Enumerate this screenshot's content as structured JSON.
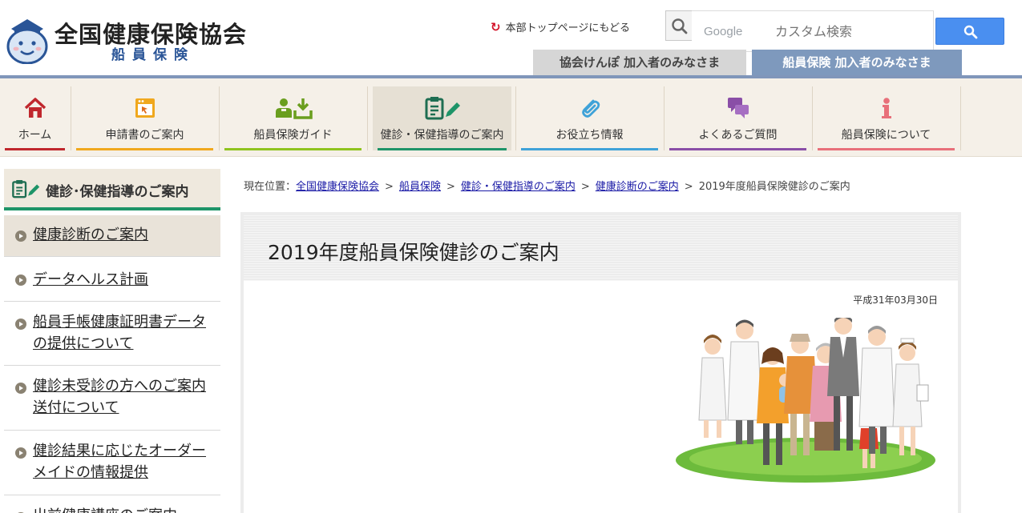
{
  "header": {
    "org_name": "全国健康保険協会",
    "org_sub": "船員保険",
    "back_link": "本部トップページにもどる",
    "search": {
      "brand": "Google",
      "placeholder": "カスタム検索"
    },
    "tabs": [
      {
        "label": "協会けんぽ 加入者のみなさま"
      },
      {
        "label": "船員保険 加入者のみなさま"
      }
    ]
  },
  "nav": [
    {
      "label": "ホーム",
      "icon": "home-icon",
      "color": "#c0272d"
    },
    {
      "label": "申請書のご案内",
      "icon": "form-icon",
      "color": "#f0a81e"
    },
    {
      "label": "船員保険ガイド",
      "icon": "guide-icon",
      "color": "#8fc31f"
    },
    {
      "label": "健診・保健指導のご案内",
      "icon": "clipboard-icon",
      "color": "#1e9468"
    },
    {
      "label": "お役立ち情報",
      "icon": "paperclip-icon",
      "color": "#3fa2d8"
    },
    {
      "label": "よくあるご質問",
      "icon": "chat-icon",
      "color": "#8a4ea7"
    },
    {
      "label": "船員保険について",
      "icon": "info-icon",
      "color": "#e8707a"
    }
  ],
  "sidebar": {
    "title": "健診･保健指導のご案内",
    "items": [
      {
        "label": "健康診断のご案内"
      },
      {
        "label": "データヘルス計画"
      },
      {
        "label": "船員手帳健康証明書データの提供について"
      },
      {
        "label": "健診未受診の方へのご案内送付について"
      },
      {
        "label": "健診結果に応じたオーダーメイドの情報提供"
      },
      {
        "label": "出前健康講座のご案内"
      }
    ]
  },
  "breadcrumb": {
    "prefix": "現在位置：",
    "links": [
      "全国健康保険協会",
      "船員保険",
      "健診・保健指導のご案内",
      "健康診断のご案内"
    ],
    "current": "2019年度船員保険健診のご案内"
  },
  "main": {
    "title": "2019年度船員保険健診のご案内",
    "date": "平成31年03月30日"
  },
  "colors": {
    "accent_green": "#1e9468",
    "header_rule": "#8096ba",
    "search_button": "#4a8ff0",
    "active_tab": "#7e99bd"
  }
}
